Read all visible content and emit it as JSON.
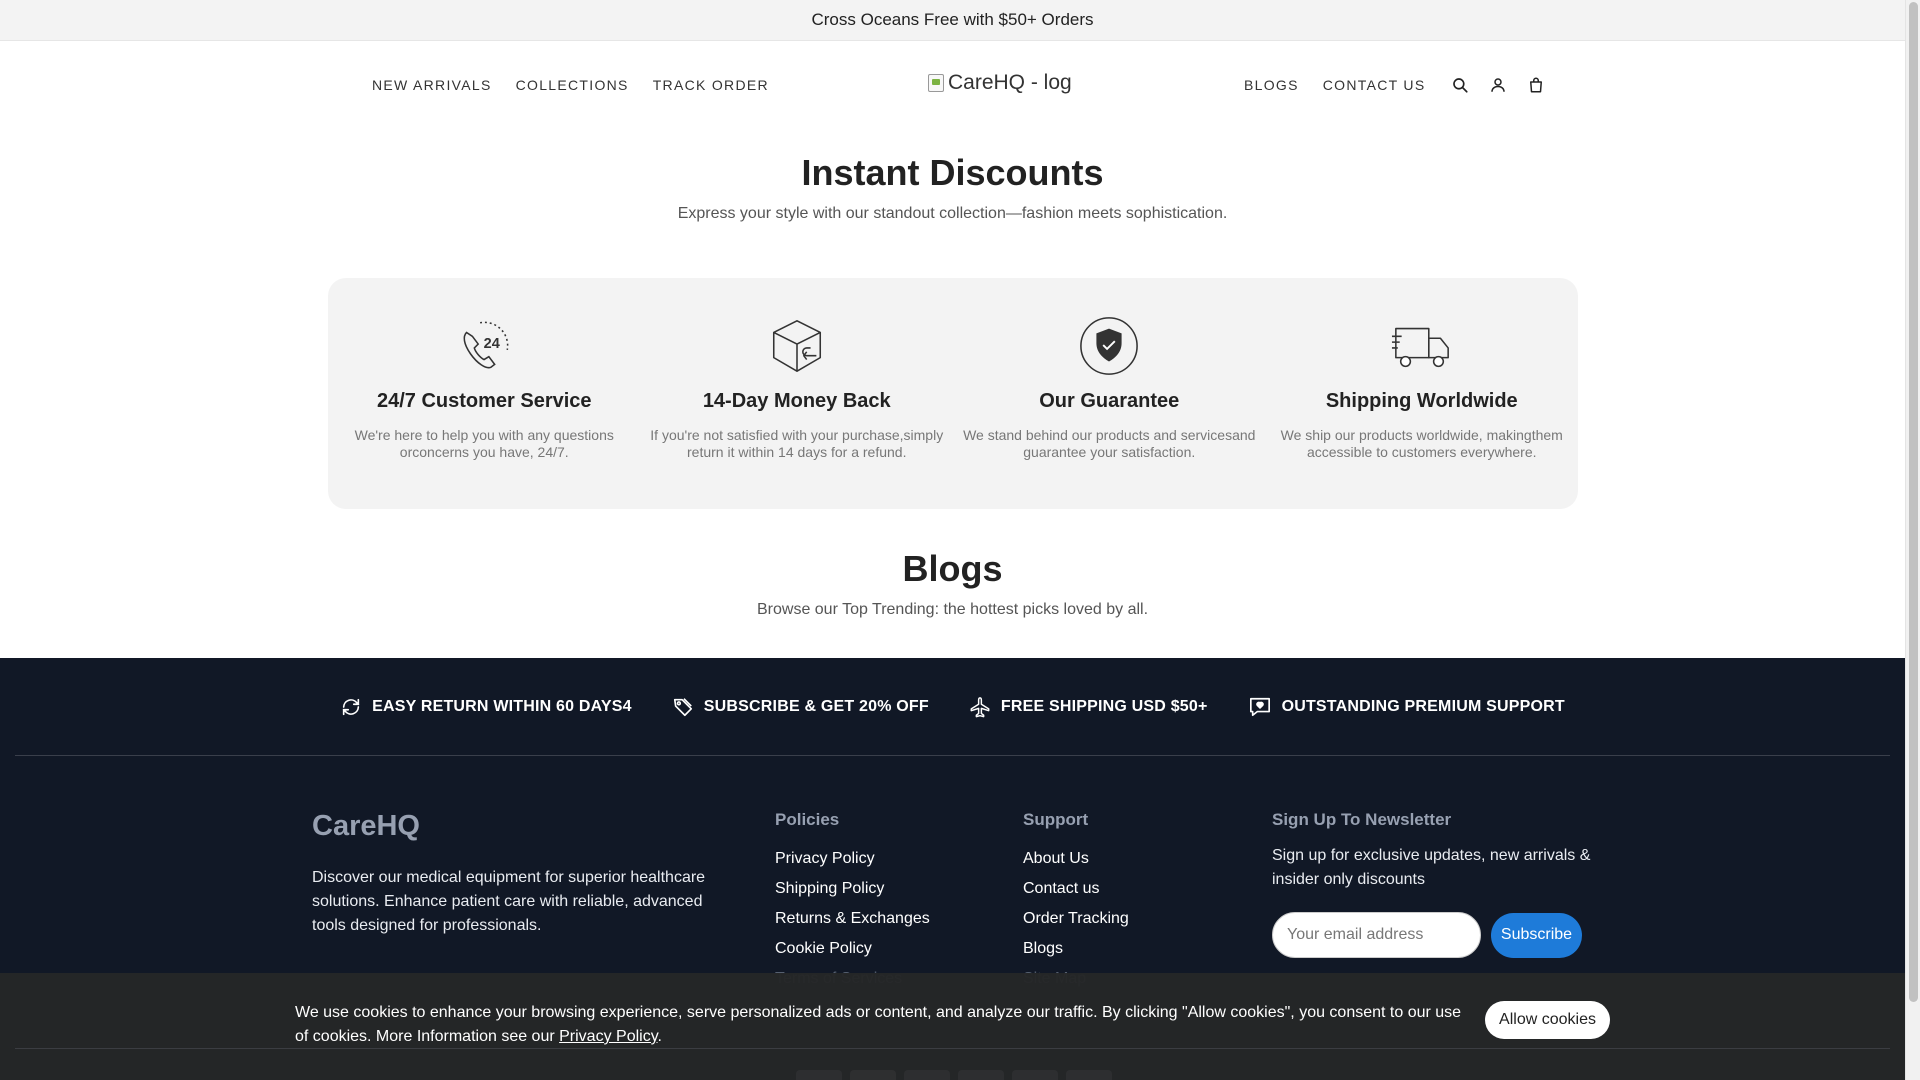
{
  "announcement": {
    "text": "Cross Oceans Free with $50+ Orders"
  },
  "header": {
    "nav_left": [
      "NEW ARRIVALS",
      "COLLECTIONS",
      "TRACK ORDER"
    ],
    "logo_alt": "CareHQ - log",
    "nav_right": [
      "BLOGS",
      "CONTACT US"
    ],
    "icons": [
      "search-icon",
      "user-icon",
      "cart-icon"
    ]
  },
  "discounts": {
    "title": "Instant Discounts",
    "subtitle": "Express your style with our standout collection—fashion meets sophistication.",
    "features": [
      {
        "icon": "phone-24-icon",
        "badge": "24",
        "title": "24/7 Customer Service",
        "desc": "We're here to help you with any questions orconcerns you have, 24/7."
      },
      {
        "icon": "box-return-icon",
        "title": "14-Day Money Back",
        "desc": "If you're not satisfied with your purchase,simply return it within 14 days for a refund."
      },
      {
        "icon": "shield-check-icon",
        "title": "Our Guarantee",
        "desc": "We stand behind our products and servicesand guarantee your satisfaction."
      },
      {
        "icon": "delivery-truck-icon",
        "title": "Shipping Worldwide",
        "desc": "We ship our products worldwide, makingthem accessible to customers everywhere."
      }
    ]
  },
  "blogs": {
    "title": "Blogs",
    "subtitle": "Browse our Top Trending: the hottest picks loved by all."
  },
  "footer": {
    "perks": [
      {
        "icon": "refresh-icon",
        "label": "EASY RETURN WITHIN 60 DAYS4"
      },
      {
        "icon": "tag-icon",
        "label": "SUBSCRIBE & GET 20% OFF"
      },
      {
        "icon": "airplane-icon",
        "label": "FREE SHIPPING USD $50+"
      },
      {
        "icon": "support-chat-icon",
        "label": "OUTSTANDING PREMIUM SUPPORT"
      }
    ],
    "brand": "CareHQ",
    "brand_desc": "Discover our medical equipment for superior healthcare solutions. Enhance patient care with reliable, advanced tools designed for professionals.",
    "policies": {
      "title": "Policies",
      "links": [
        "Privacy Policy",
        "Shipping Policy",
        "Returns & Exchanges",
        "Cookie Policy",
        "Terms of Services"
      ]
    },
    "support": {
      "title": "Support",
      "links": [
        "About Us",
        "Contact us",
        "Order Tracking",
        "Blogs",
        "Site Map"
      ]
    },
    "newsletter": {
      "title": "Sign Up To Newsletter",
      "desc": "Sign up for exclusive updates, new arrivals & insider only discounts",
      "placeholder": "Your email address",
      "button": "Subscribe"
    }
  },
  "cookie": {
    "text": "We use cookies to enhance your browsing experience, serve personalized ads or content, and analyze our traffic. By clicking \"Allow cookies\", you consent to our use of cookies. More Information see our ",
    "link": "Privacy Policy",
    "tail": ".",
    "button": "Allow cookies"
  },
  "colors": {
    "footer_bg": "#111826",
    "accent_blue": "#1e7bd9",
    "muted_heading": "#97a0b1"
  }
}
